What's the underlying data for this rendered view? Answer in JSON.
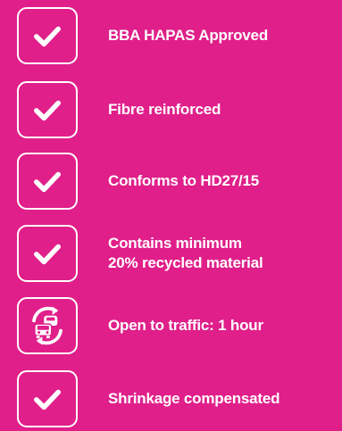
{
  "theme": {
    "background": "#E01F8A",
    "foreground": "#FFFFFF"
  },
  "features": [
    {
      "icon": "checkmark-icon",
      "label": "BBA HAPAS Approved"
    },
    {
      "icon": "checkmark-icon",
      "label": "Fibre reinforced"
    },
    {
      "icon": "checkmark-icon",
      "label": "Conforms to HD27/15"
    },
    {
      "icon": "checkmark-icon",
      "label": "Contains minimum\n20% recycled material"
    },
    {
      "icon": "traffic-cars-icon",
      "label": "Open to traffic: 1 hour"
    },
    {
      "icon": "checkmark-icon",
      "label": "Shrinkage compensated"
    }
  ]
}
